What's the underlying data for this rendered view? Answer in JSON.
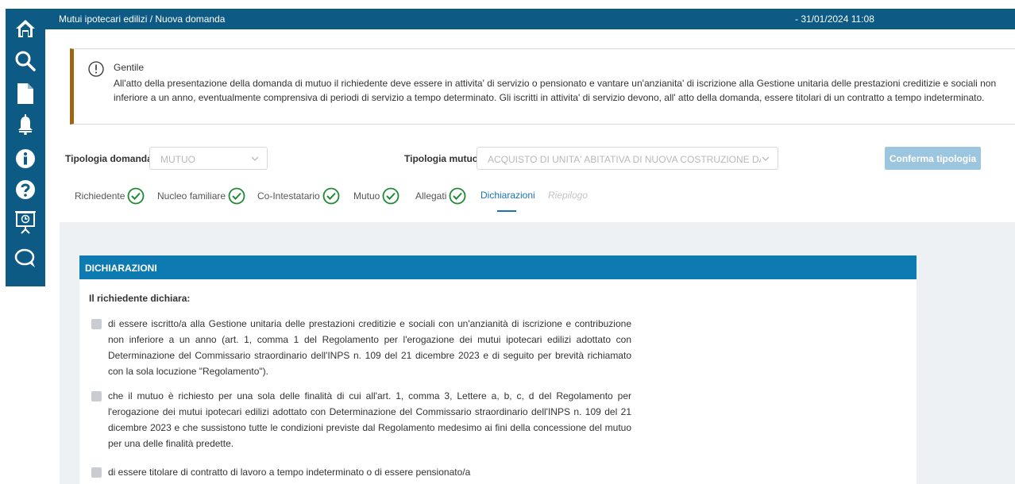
{
  "sidebar": {
    "items": [
      {
        "icon": "home-icon"
      },
      {
        "icon": "search-icon"
      },
      {
        "icon": "document-icon"
      },
      {
        "icon": "bell-icon"
      },
      {
        "icon": "info-icon"
      },
      {
        "icon": "help-icon"
      },
      {
        "icon": "presentation-icon"
      },
      {
        "icon": "chat-icon"
      }
    ]
  },
  "topbar": {
    "breadcrumb": "Mutui ipotecari edilizi / Nuova domanda",
    "datetime": "- 31/01/2024 11:08"
  },
  "alert": {
    "title": "Gentile",
    "body": "All'atto della presentazione della domanda di mutuo il richiedente deve essere in attivita' di servizio o pensionato e vantare un'anzianita' di iscrizione alla Gestione unitaria delle prestazioni creditizie e sociali non inferiore a un anno, eventualmente comprensiva di periodi di servizio a tempo determinato. Gli iscritti in attivita' di servizio devono, all' atto della domanda, essere titolari di un contratto a tempo indeterminato."
  },
  "form": {
    "tipologia_domanda_label": "Tipologia domanda",
    "tipologia_domanda_value": "MUTUO",
    "tipologia_mutuo_label": "Tipologia mutuo",
    "tipologia_mutuo_value": "ACQUISTO DI UNITA' ABITATIVA DI NUOVA COSTRUZIONE DA IMPR",
    "conferma_label": "Conferma tipologia"
  },
  "steps": [
    {
      "label": "Richiedente",
      "done": true
    },
    {
      "label": "Nucleo familiare",
      "done": true
    },
    {
      "label": "Co-Intestatario",
      "done": true
    },
    {
      "label": "Mutuo",
      "done": true
    },
    {
      "label": "Allegati",
      "done": true
    },
    {
      "label": "Dichiarazioni",
      "active": true
    },
    {
      "label": "Riepilogo",
      "disabled": true
    }
  ],
  "colors": {
    "primary": "#0d5a85",
    "header": "#0e7ab2",
    "check": "#1f8a36",
    "alert_border": "#a0650f"
  },
  "dichiarazioni": {
    "title": "DICHIARAZIONI",
    "subtitle": "Il richiedente dichiara:",
    "items": [
      "di essere iscritto/a alla Gestione unitaria delle prestazioni creditizie e sociali con un'anzianità di iscrizione e contribuzione non inferiore a un anno (art. 1, comma 1 del Regolamento per l'erogazione dei mutui ipotecari edilizi adottato con Determinazione del Commissario straordinario dell'INPS n. 109 del 21 dicembre 2023 e di seguito per brevità richiamato con la sola locuzione \"Regolamento\").",
      "che il mutuo è richiesto per una sola delle finalità di cui all'art. 1, comma 3, Lettere a, b, c, d del Regolamento per l'erogazione dei mutui ipotecari edilizi adottato con Determinazione del Commissario straordinario dell'INPS n. 109 del 21 dicembre 2023 e che sussistono tutte le condizioni previste dal Regolamento medesimo ai fini della concessione del mutuo per una delle finalità predette.",
      "di essere titolare di contratto di lavoro a tempo indeterminato o di essere pensionato/a"
    ]
  }
}
